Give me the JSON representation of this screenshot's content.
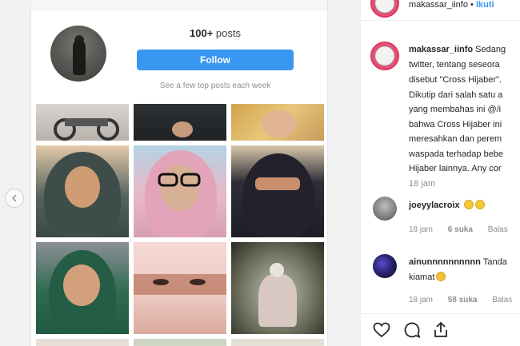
{
  "profile_card": {
    "posts_count": "100+",
    "posts_label": "posts",
    "follow_label": "Follow",
    "top_posts_note": "See a few top posts each week"
  },
  "post_header": {
    "username": "makassar_iinfo",
    "separator": " • ",
    "follow_label": "Ikuti"
  },
  "caption": {
    "username": "makassar_iinfo",
    "first_line_text": "Sedang",
    "lines": [
      "twitter, tentang seseora",
      "disebut \"Cross Hijaber\".",
      "Dikutip dari salah satu a",
      "yang membahas ini @/i",
      "bahwa Cross Hijaber ini",
      "meresahkan dan perem",
      "waspada terhadap bebe",
      "Hijaber lainnya. Any cor"
    ],
    "time": "18 jam"
  },
  "comments": [
    {
      "username": "joeyylacroix",
      "text": "",
      "emoji_count": 2,
      "time": "18 jam",
      "likes": "6 suka",
      "reply": "Balas"
    },
    {
      "username": "ainunnnnnnnnnn",
      "text": "Tanda",
      "text2": "kiamat",
      "emoji_count": 1,
      "time": "18 jam",
      "likes": "58 suka",
      "reply": "Balas"
    }
  ],
  "icons": {
    "like": "heart-icon",
    "comment": "comment-icon",
    "share": "share-icon",
    "prev": "chevron-left-icon"
  },
  "colors": {
    "accent": "#3897f0",
    "muted": "#8e8e8e",
    "text": "#262626"
  }
}
